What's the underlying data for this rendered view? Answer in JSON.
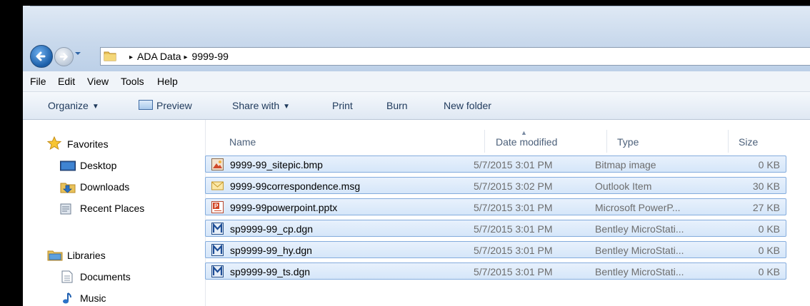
{
  "address": {
    "crumbs": [
      "ADA Data",
      "9999-99"
    ],
    "separator": "▸"
  },
  "menu": [
    "File",
    "Edit",
    "View",
    "Tools",
    "Help"
  ],
  "toolbar": {
    "organize": "Organize",
    "preview": "Preview",
    "share_with": "Share with",
    "print": "Print",
    "burn": "Burn",
    "new_folder": "New folder",
    "dropdown_glyph": "▼"
  },
  "nav": {
    "favorites_title": "Favorites",
    "favorites": [
      "Desktop",
      "Downloads",
      "Recent Places"
    ],
    "libraries_title": "Libraries",
    "libraries": [
      "Documents",
      "Music"
    ]
  },
  "columns": {
    "name": "Name",
    "date": "Date modified",
    "type": "Type",
    "size": "Size",
    "sort_glyph": "▲"
  },
  "files": [
    {
      "name": "9999-99_sitepic.bmp",
      "date": "5/7/2015 3:01 PM",
      "type": "Bitmap image",
      "size": "0 KB",
      "icon": "bitmap-file-icon"
    },
    {
      "name": "9999-99correspondence.msg",
      "date": "5/7/2015 3:02 PM",
      "type": "Outlook Item",
      "size": "30 KB",
      "icon": "outlook-message-icon"
    },
    {
      "name": "9999-99powerpoint.pptx",
      "date": "5/7/2015 3:01 PM",
      "type": "Microsoft PowerP...",
      "size": "27 KB",
      "icon": "powerpoint-file-icon"
    },
    {
      "name": "sp9999-99_cp.dgn",
      "date": "5/7/2015 3:01 PM",
      "type": "Bentley MicroStati...",
      "size": "0 KB",
      "icon": "microstation-file-icon"
    },
    {
      "name": "sp9999-99_hy.dgn",
      "date": "5/7/2015 3:01 PM",
      "type": "Bentley MicroStati...",
      "size": "0 KB",
      "icon": "microstation-file-icon"
    },
    {
      "name": "sp9999-99_ts.dgn",
      "date": "5/7/2015 3:01 PM",
      "type": "Bentley MicroStati...",
      "size": "0 KB",
      "icon": "microstation-file-icon"
    }
  ],
  "colors": {
    "selection_border": "#84acdd",
    "selection_fill": "#d5e6f9",
    "command_text": "#1e395b"
  }
}
